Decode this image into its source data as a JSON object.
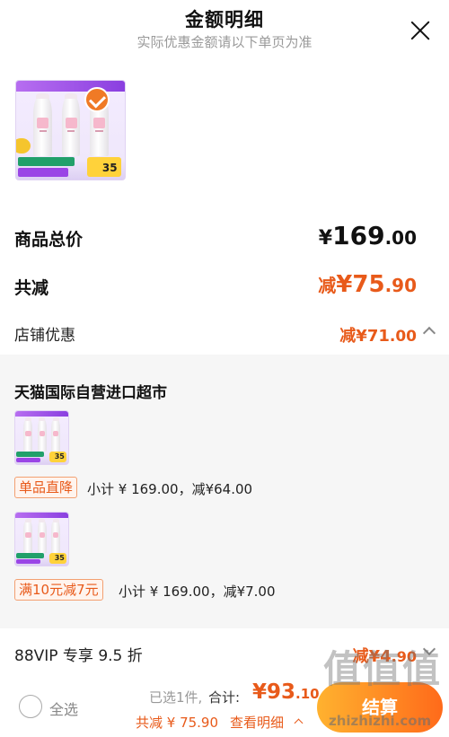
{
  "header": {
    "title": "金额明细",
    "subtitle": "实际优惠金额请以下单页为准"
  },
  "product_thumb": {
    "price_tag": "35"
  },
  "summary": {
    "total_label": "商品总价",
    "total_yen": "¥",
    "total_int": "169",
    "total_cents": ".00",
    "reduce_label": "共减",
    "reduce_prefix": "减",
    "reduce_int": "¥75",
    "reduce_cents": ".90"
  },
  "shop_discount": {
    "label": "店铺优惠",
    "value_main": "减¥71",
    "value_cents": ".00"
  },
  "store": {
    "name": "天猫国际自营进口超市",
    "items": [
      {
        "price_tag": "35",
        "promo": "单品直降",
        "text": "小计 ¥ 169.00，减¥64.00"
      },
      {
        "price_tag": "35",
        "promo": "满10元减7元",
        "text": "小计 ¥ 169.00，减¥7.00"
      }
    ]
  },
  "vip": {
    "label": "88VIP 专享 9.5 折",
    "value_main": "减¥4",
    "value_cents": ".90"
  },
  "footer": {
    "select_all": "全选",
    "selected": "已选1件,",
    "sum_label": "合计:",
    "sum_main": "¥93",
    "sum_cents": ".10",
    "save": "共减 ¥ 75.90",
    "detail": "查看明细",
    "checkout": "结算"
  },
  "watermark": {
    "glyphs": [
      "值",
      "值",
      "值"
    ],
    "url": "zhizhizhi.com"
  },
  "colors": {
    "accent": "#e85a1a",
    "checkout_start": "#ffb22f",
    "checkout_end": "#ff6a1a",
    "panel_bg": "#f6f6f6"
  }
}
